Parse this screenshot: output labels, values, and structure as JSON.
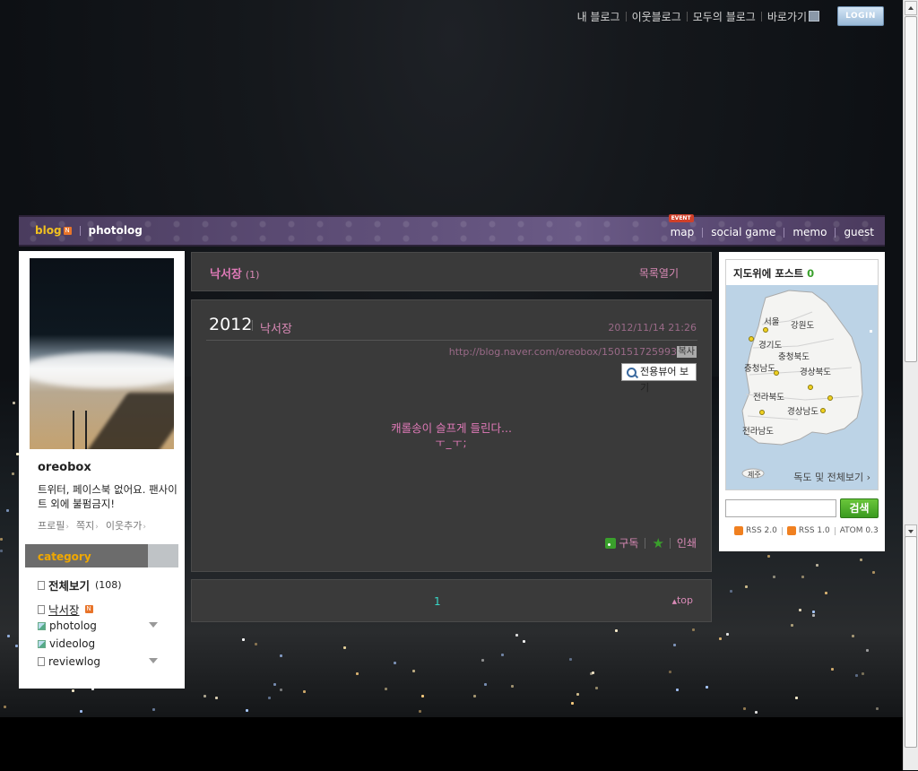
{
  "util_nav": {
    "links": [
      "내 블로그",
      "이웃블로그",
      "모두의 블로그",
      "바로가기"
    ],
    "login": "LOGIN"
  },
  "menu": {
    "blog": "blog",
    "new_badge": "N",
    "photolog": "photolog",
    "event_badge": "EVENT",
    "items": [
      "map",
      "social game",
      "memo",
      "guest"
    ]
  },
  "profile": {
    "name": "oreobox",
    "desc": "트위터, 페이스북 없어요. 팬사이트 외에 불펌금지!",
    "links": [
      "프로필",
      "쪽지",
      "이웃추가"
    ]
  },
  "category": {
    "header": "category",
    "all_label": "전체보기",
    "all_count": "(108)",
    "items": [
      "낙서장",
      "photolog",
      "videolog",
      "reviewlog"
    ]
  },
  "list_bar": {
    "title": "낙서장",
    "count": "(1)",
    "open_list": "목록열기"
  },
  "post": {
    "title": "2012",
    "category": "낙서장",
    "date": "2012/11/14 21:26",
    "url": "http://blog.naver.com/oreobox/150151725993",
    "copy": "복사",
    "viewer": "전용뷰어 보기",
    "body_line1": "캐롤송이 슬프게 들린다...",
    "body_line2": "ㅜ_ㅜ;",
    "subscribe": "구독",
    "print": "인쇄"
  },
  "pager": {
    "page": "1",
    "top": "top"
  },
  "map_widget": {
    "title": "지도위에 포스트",
    "count": "0",
    "regions": [
      "서울",
      "강원도",
      "경기도",
      "충청북도",
      "충청남도",
      "경상북도",
      "전라북도",
      "경상남도",
      "전라남도",
      "제주"
    ],
    "more": "독도 및 전체보기"
  },
  "search": {
    "button": "검색",
    "placeholder": ""
  },
  "feeds": [
    "RSS 2.0",
    "RSS 1.0",
    "ATOM 0.3"
  ]
}
